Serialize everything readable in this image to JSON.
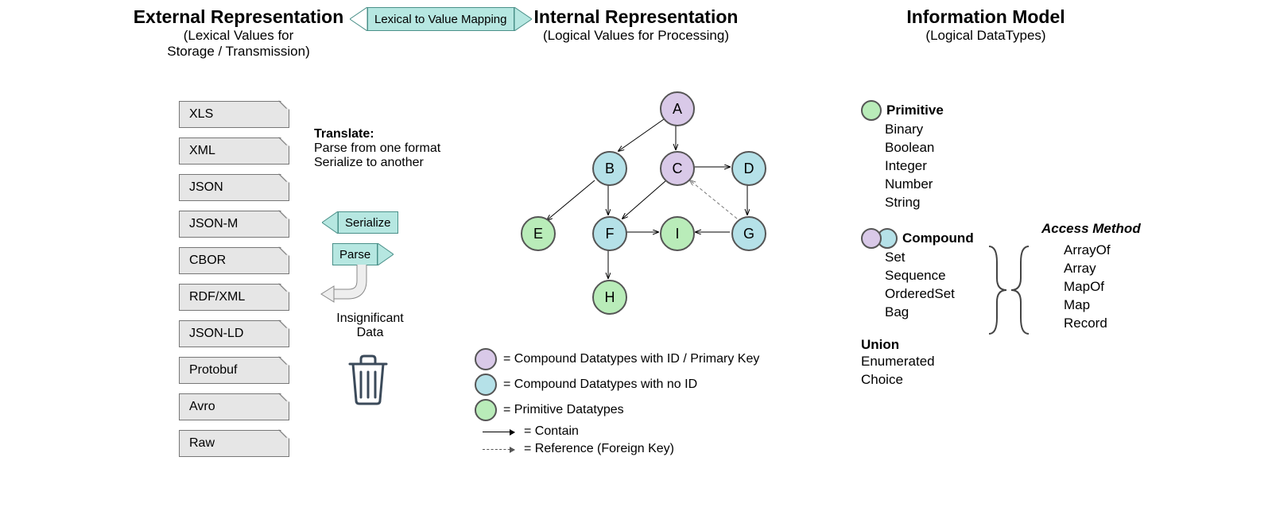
{
  "columns": {
    "external": {
      "title": "External Representation",
      "sub1": "(Lexical Values for",
      "sub2": "Storage / Transmission)"
    },
    "internal": {
      "title": "Internal Representation",
      "sub": "(Logical Values for Processing)"
    },
    "infomodel": {
      "title": "Information Model",
      "sub": "(Logical DataTypes)"
    }
  },
  "bidir_label": "Lexical to Value Mapping",
  "formats": [
    "XLS",
    "XML",
    "JSON",
    "JSON-M",
    "CBOR",
    "RDF/XML",
    "JSON-LD",
    "Protobuf",
    "Avro",
    "Raw"
  ],
  "translate": {
    "head": "Translate:",
    "line1": "Parse from one format",
    "line2": "Serialize to another"
  },
  "serialize_label": "Serialize",
  "parse_label": "Parse",
  "insignificant": {
    "l1": "Insignificant",
    "l2": "Data"
  },
  "nodes": {
    "A": "A",
    "B": "B",
    "C": "C",
    "D": "D",
    "E": "E",
    "F": "F",
    "G": "G",
    "H": "H",
    "I": "I"
  },
  "graph_legend": {
    "purple": "= Compound Datatypes with ID / Primary Key",
    "cyan": "= Compound Datatypes with no ID",
    "green": "= Primitive Datatypes",
    "solid": "= Contain",
    "dashed": "= Reference (Foreign Key)"
  },
  "info": {
    "primitive": {
      "head": "Primitive",
      "items": [
        "Binary",
        "Boolean",
        "Integer",
        "Number",
        "String"
      ]
    },
    "compound": {
      "head": "Compound",
      "items": [
        "Set",
        "Sequence",
        "OrderedSet",
        "Bag"
      ]
    },
    "union": {
      "head": "Union",
      "items": [
        "Enumerated",
        "Choice"
      ]
    },
    "access": {
      "head": "Access Method",
      "items": [
        "ArrayOf",
        "Array",
        "MapOf",
        "Map",
        "Record"
      ]
    }
  }
}
